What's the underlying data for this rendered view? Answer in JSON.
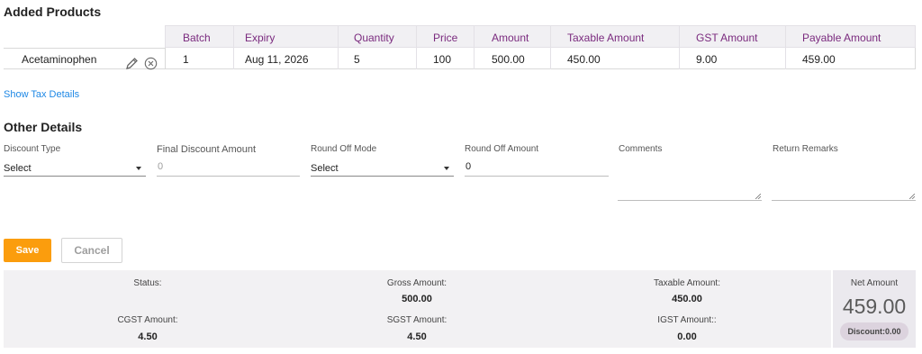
{
  "added_products": {
    "title": "Added Products",
    "columns": [
      "Batch",
      "Expiry",
      "Quantity",
      "Price",
      "Amount",
      "Taxable Amount",
      "GST Amount",
      "Payable Amount"
    ],
    "rows": [
      {
        "product": "Acetaminophen",
        "cells": [
          "1",
          "Aug 11, 2026",
          "5",
          "100",
          "500.00",
          "450.00",
          "9.00",
          "459.00"
        ]
      }
    ]
  },
  "show_tax_details": "Show Tax Details",
  "other_details": {
    "title": "Other Details",
    "discount_type": {
      "label": "Discount Type",
      "value": "Select"
    },
    "final_discount_amount": {
      "label": "Final Discount Amount",
      "value": "0"
    },
    "round_off_mode": {
      "label": "Round Off Mode",
      "value": "Select"
    },
    "round_off_amount": {
      "label": "Round Off Amount",
      "value": "0"
    },
    "comments": {
      "label": "Comments",
      "value": ""
    },
    "return_remarks": {
      "label": "Return Remarks",
      "value": ""
    }
  },
  "actions": {
    "save": "Save",
    "cancel": "Cancel"
  },
  "summary": {
    "status": {
      "label": "Status:",
      "value": ""
    },
    "gross_amount": {
      "label": "Gross Amount:",
      "value": "500.00"
    },
    "taxable_amount": {
      "label": "Taxable Amount:",
      "value": "450.00"
    },
    "cgst_amount": {
      "label": "CGST Amount:",
      "value": "4.50"
    },
    "sgst_amount": {
      "label": "SGST Amount:",
      "value": "4.50"
    },
    "igst_amount": {
      "label": "IGST Amount::",
      "value": "0.00"
    },
    "net_amount": {
      "label": "Net Amount",
      "value": "459.00"
    },
    "discount": "Discount:0.00"
  },
  "colors": {
    "header_text": "#7a2a7e",
    "link": "#1e88e5",
    "save_button": "#fb9d0d"
  },
  "icons": {
    "edit": "pencil-icon",
    "remove": "circle-x-icon"
  }
}
